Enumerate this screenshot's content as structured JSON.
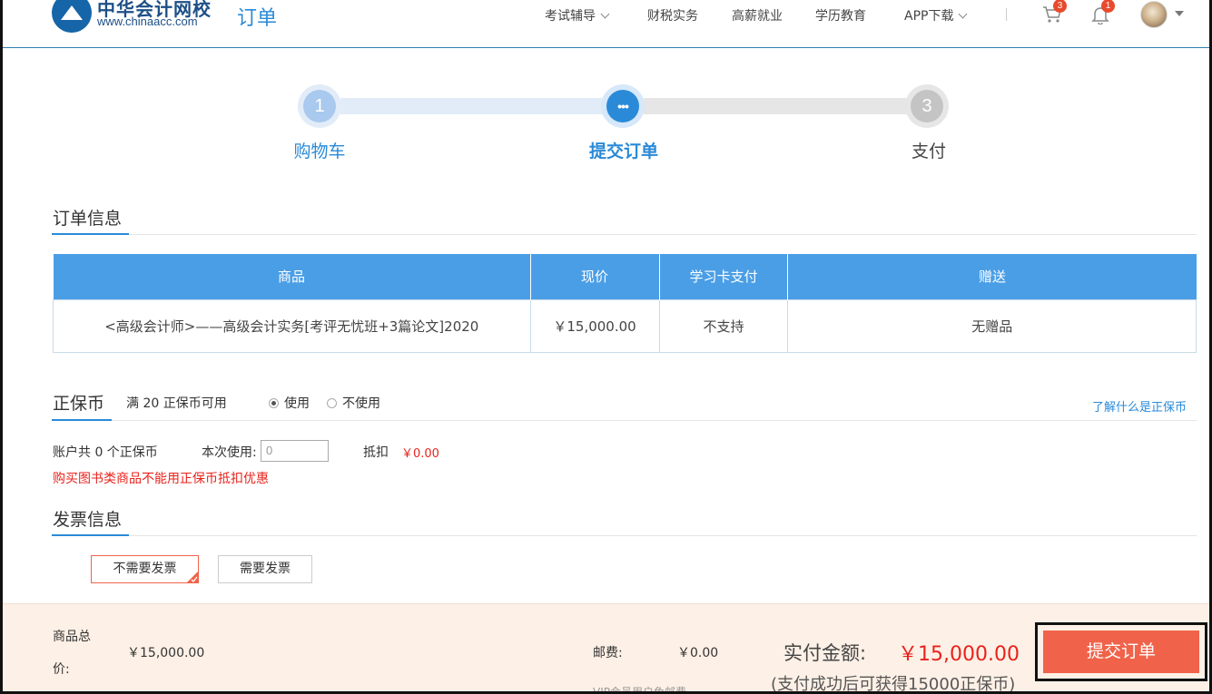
{
  "header": {
    "logo_cn": "中华会计网校",
    "logo_en": "www.chinaacc.com",
    "page_title": "订单",
    "nav": [
      "考试辅导",
      "财税实务",
      "高薪就业",
      "学历教育",
      "APP下载"
    ],
    "cart_count": "3",
    "notify_count": "1"
  },
  "steps": [
    {
      "num": "1",
      "label": "购物车",
      "state": "done"
    },
    {
      "num": "•••",
      "label": "提交订单",
      "state": "active"
    },
    {
      "num": "3",
      "label": "支付",
      "state": "todo"
    }
  ],
  "order_info": {
    "title": "订单信息",
    "columns": [
      "商品",
      "现价",
      "学习卡支付",
      "赠送"
    ],
    "rows": [
      [
        "<高级会计师>——高级会计实务[考评无忧班+3篇论文]2020",
        "￥15,000.00",
        "不支持",
        "无赠品"
      ]
    ]
  },
  "coin": {
    "title": "正保币",
    "desc": "满 20 正保币可用",
    "opt_use": "使用",
    "opt_nouse": "不使用",
    "link": "了解什么是正保币",
    "balance": "账户共 0 个正保币",
    "use_label": "本次使用:",
    "use_value": "0",
    "deduct_label": "抵扣",
    "deduct_value": "￥0.00",
    "warning": "购买图书类商品不能用正保币抵扣优惠"
  },
  "invoice": {
    "title": "发票信息",
    "opt_none": "不需要发票",
    "opt_need": "需要发票"
  },
  "summary": {
    "goods_total_label_1": "商品总",
    "goods_total_label_2": "价:",
    "goods_total": "￥15,000.00",
    "postage_label": "邮费:",
    "postage": "￥0.00",
    "postage_note": "VIP会员用户免邮费",
    "pay_label": "实付金额:",
    "pay_amount": "￥15,000.00",
    "pay_note": "(支付成功后可获得15000正保币)",
    "submit": "提交订单"
  },
  "colors": {
    "brand_blue": "#2a8ad8",
    "table_header": "#4a9ee6",
    "accent_red": "#e8231c",
    "submit": "#f0634a"
  }
}
